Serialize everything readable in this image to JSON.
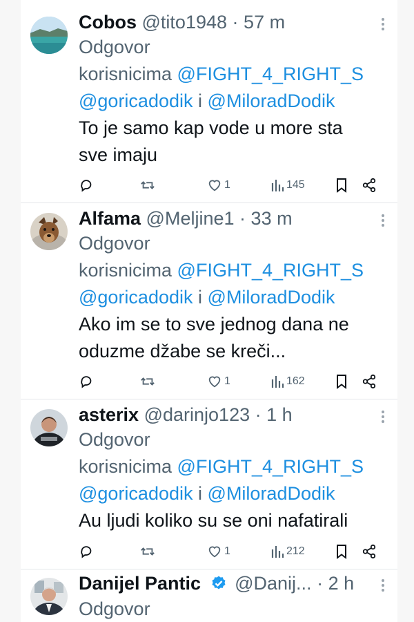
{
  "replies": [
    {
      "name": "Cobos",
      "handle": "@tito1948",
      "time": "57 m",
      "verified": false,
      "replying_prefix": "Odgovor",
      "replying_word": "korisnicima",
      "mention_1": "@FIGHT_4_RIGHT_S",
      "mention_2": "@goricadodik",
      "joiner": "i",
      "mention_3": "@MiloradDodik",
      "text_line_1": "To je samo kap vode u more sta",
      "text_line_2": "sve imaju",
      "likes": "1",
      "views": "145",
      "avatar": "lake-landscape-avatar"
    },
    {
      "name": "Alfama",
      "handle": "@Meljine1",
      "time": "33 m",
      "verified": false,
      "replying_prefix": "Odgovor",
      "replying_word": "korisnicima",
      "mention_1": "@FIGHT_4_RIGHT_S",
      "mention_2": "@goricadodik",
      "joiner": "i",
      "mention_3": "@MiloradDodik",
      "text_line_1": "Ako im se to sve jednog dana ne",
      "text_line_2": "oduzme džabe se kreči...",
      "likes": "1",
      "views": "162",
      "avatar": "dog-avatar"
    },
    {
      "name": "asterix",
      "handle": "@darinjo123",
      "time": "1 h",
      "verified": false,
      "replying_prefix": "Odgovor",
      "replying_word": "korisnicima",
      "mention_1": "@FIGHT_4_RIGHT_S",
      "mention_2": "@goricadodik",
      "joiner": "i",
      "mention_3": "@MiloradDodik",
      "text_line_1": "Au ljudi koliko su se oni nafatirali",
      "text_line_2": "",
      "likes": "1",
      "views": "212",
      "avatar": "person-avatar"
    },
    {
      "name": "Danijel Pantic",
      "handle": "@Danij...",
      "time": "2 h",
      "verified": true,
      "replying_prefix": "Odgovor",
      "avatar": "person-suit-avatar"
    }
  ],
  "separator": "·",
  "icons": {
    "reply": "reply-icon",
    "retweet": "retweet-icon",
    "like": "heart-icon",
    "views": "views-chart-icon",
    "bookmark": "bookmark-icon",
    "share": "share-icon",
    "more": "more-options-icon",
    "verified": "verified-badge-icon"
  },
  "colors": {
    "mention": "#1d8fe0",
    "secondary_text": "#536471",
    "verified_blue": "#1d9bf0"
  }
}
